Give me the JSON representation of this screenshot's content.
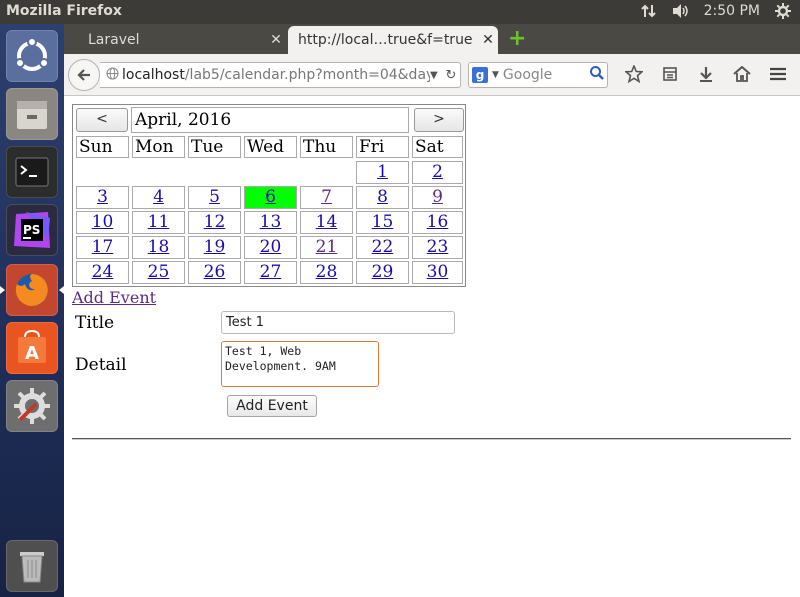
{
  "system": {
    "window_title": "Mozilla Firefox",
    "clock": "2:50 PM"
  },
  "browser": {
    "tabs": [
      {
        "label": "Laravel"
      },
      {
        "label": "http://local…true&f=true"
      }
    ],
    "url": {
      "host": "localhost",
      "path": "/lab5/calendar.php?month=04&day="
    },
    "search_placeholder": "Google"
  },
  "calendar": {
    "prev_label": "<",
    "next_label": ">",
    "month_title": "April, 2016",
    "weekdays": [
      "Sun",
      "Mon",
      "Tue",
      "Wed",
      "Thu",
      "Fri",
      "Sat"
    ],
    "weeks": [
      [
        "",
        "",
        "",
        "",
        "",
        "1",
        "2"
      ],
      [
        "3",
        "4",
        "5",
        "6",
        "7",
        "8",
        "9"
      ],
      [
        "10",
        "11",
        "12",
        "13",
        "14",
        "15",
        "16"
      ],
      [
        "17",
        "18",
        "19",
        "20",
        "21",
        "22",
        "23"
      ],
      [
        "24",
        "25",
        "26",
        "27",
        "28",
        "29",
        "30"
      ]
    ],
    "today": "6",
    "visited_days": [
      "7",
      "9",
      "21"
    ],
    "today_color": "#00ff00"
  },
  "form": {
    "add_event_link": "Add Event",
    "title_label": "Title",
    "title_value": "Test 1",
    "detail_label": "Detail",
    "detail_value": "Test 1, Web Development. 9AM",
    "submit_label": "Add Event"
  }
}
